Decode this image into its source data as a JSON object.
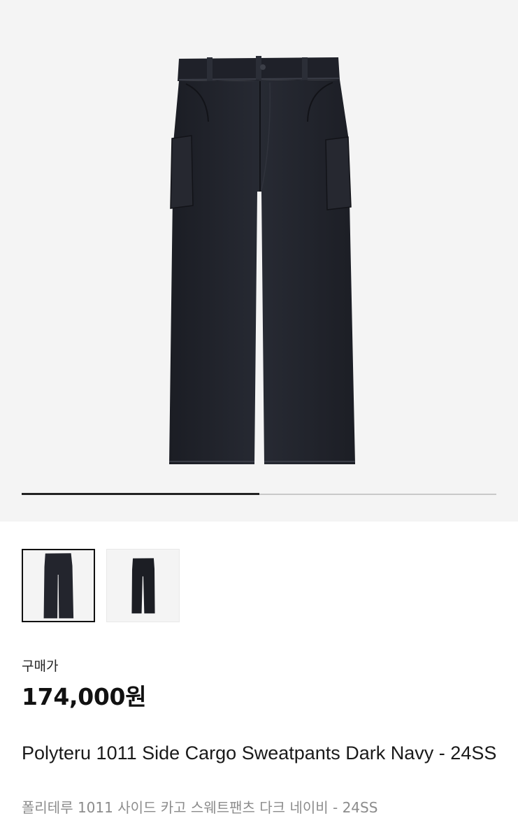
{
  "gallery": {
    "image_count": 2,
    "current_index": 1,
    "progress_fraction": 0.5,
    "product_icon": "pants-illustration",
    "colors": {
      "background": "#f4f4f4",
      "garment": "#23252d",
      "progress_fill": "#222222",
      "progress_track": "#c9c9c9"
    }
  },
  "thumbnails": [
    {
      "selected": true,
      "icon": "pants-thumbnail"
    },
    {
      "selected": false,
      "icon": "pants-thumbnail"
    }
  ],
  "price": {
    "label": "구매가",
    "value": "174,000원"
  },
  "product": {
    "name_en": "Polyteru 1011 Side Cargo Sweatpants Dark Navy - 24SS",
    "name_ko": "폴리테루 1011 사이드 카고 스웨트팬츠 다크 네이비 - 24SS"
  }
}
